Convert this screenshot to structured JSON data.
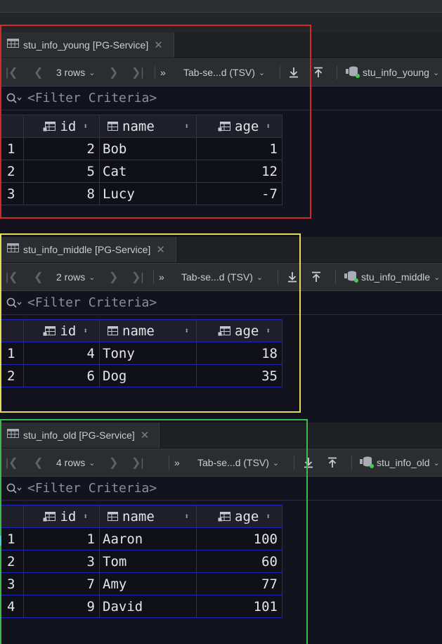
{
  "colors": {
    "frame_red": "#d02b2b",
    "frame_yellow": "#e6dc5a",
    "frame_green": "#3fb94a",
    "grid_border": "#2323b8",
    "db_dot": "#45c850"
  },
  "filter_placeholder": "<Filter Criteria>",
  "columns": {
    "id": "id",
    "name": "name",
    "age": "age"
  },
  "panels": [
    {
      "tab_label": "stu_info_young [PG-Service]",
      "rows_label": "3 rows",
      "format_label": "Tab-se...d (TSV)",
      "datasource_label": "stu_info_young",
      "rows": [
        {
          "n": "1",
          "id": "2",
          "name": "Bob",
          "age": "1"
        },
        {
          "n": "2",
          "id": "5",
          "name": "Cat",
          "age": "12"
        },
        {
          "n": "3",
          "id": "8",
          "name": "Lucy",
          "age": "-7"
        }
      ]
    },
    {
      "tab_label": "stu_info_middle [PG-Service]",
      "rows_label": "2 rows",
      "format_label": "Tab-se...d (TSV)",
      "datasource_label": "stu_info_middle",
      "rows": [
        {
          "n": "1",
          "id": "4",
          "name": "Tony",
          "age": "18"
        },
        {
          "n": "2",
          "id": "6",
          "name": "Dog",
          "age": "35"
        }
      ]
    },
    {
      "tab_label": "stu_info_old [PG-Service]",
      "rows_label": "4 rows",
      "format_label": "Tab-se...d (TSV)",
      "datasource_label": "stu_info_old",
      "rows": [
        {
          "n": "1",
          "id": "1",
          "name": "Aaron",
          "age": "100"
        },
        {
          "n": "2",
          "id": "3",
          "name": "Tom",
          "age": "60"
        },
        {
          "n": "3",
          "id": "7",
          "name": "Amy",
          "age": "77"
        },
        {
          "n": "4",
          "id": "9",
          "name": "David",
          "age": "101"
        }
      ]
    }
  ]
}
